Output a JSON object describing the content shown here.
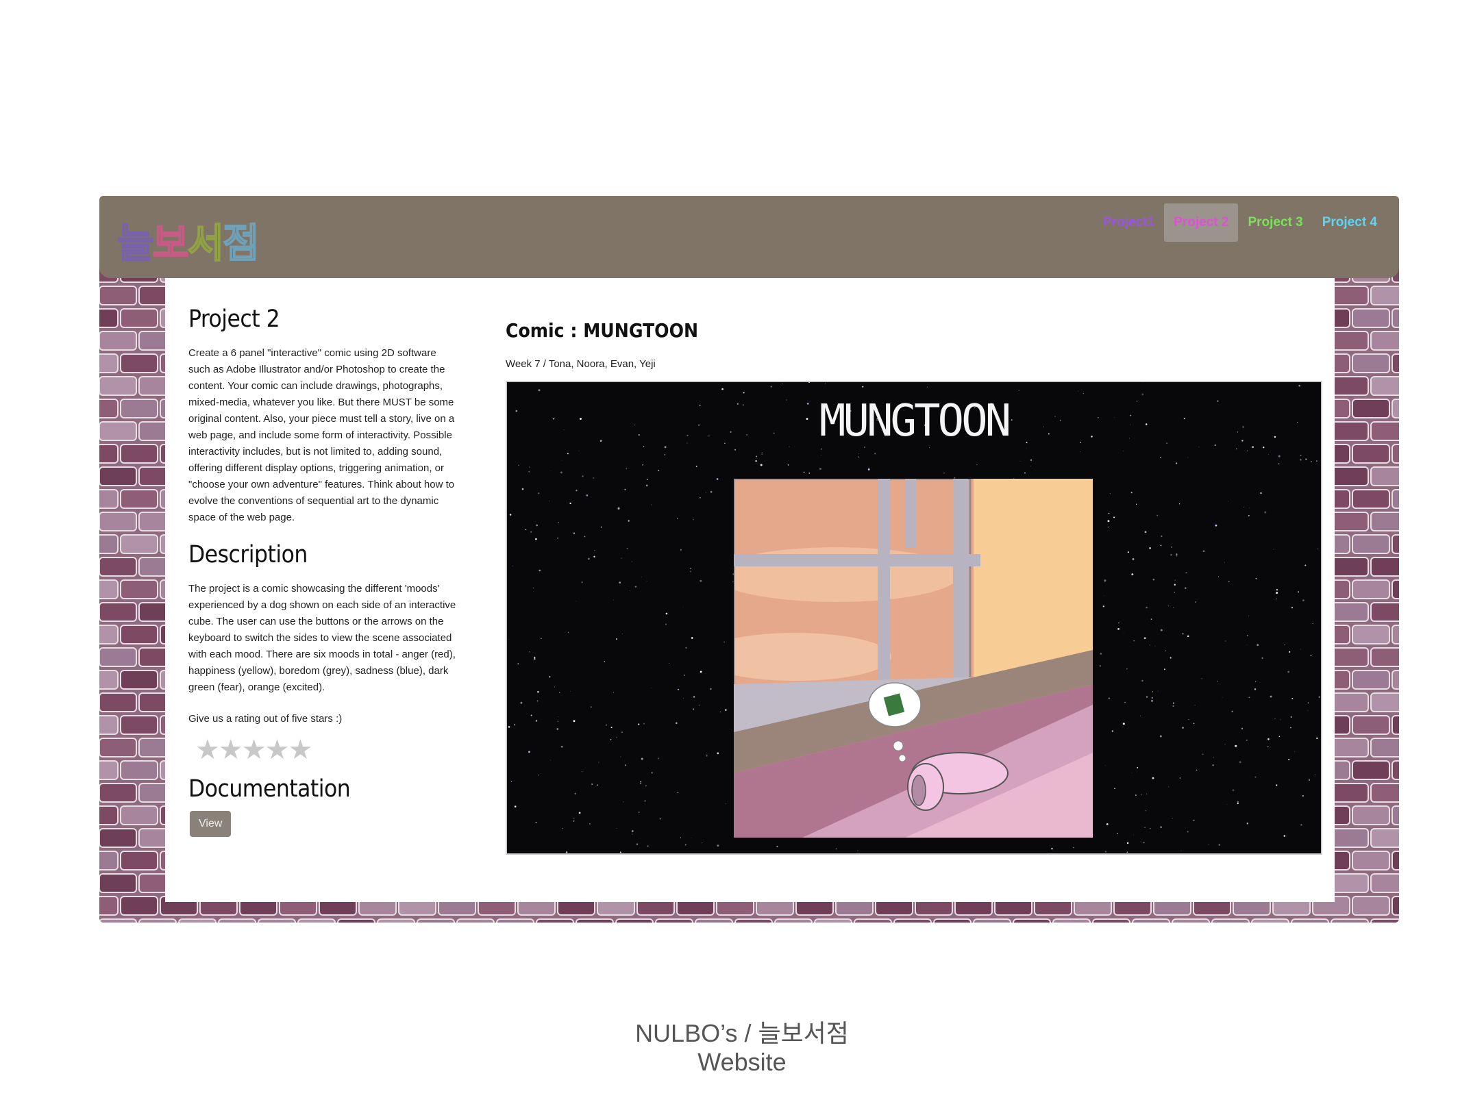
{
  "site": {
    "logo_text": "늘보서점",
    "nav": [
      {
        "label": "Project1",
        "color": "#9a55e0",
        "active": false
      },
      {
        "label": "Project 2",
        "color": "#e04fd8",
        "active": true
      },
      {
        "label": "Project 3",
        "color": "#7de05a",
        "active": false
      },
      {
        "label": "Project 4",
        "color": "#5fd4f0",
        "active": false
      }
    ]
  },
  "left": {
    "heading": "Project 2",
    "brief": "Create a 6 panel \"interactive\" comic using 2D software such as Adobe Illustrator and/or Photoshop to create the content. Your comic can include drawings, photographs, mixed-media, whatever you like. But there MUST be some original content. Also, your piece must tell a story, live on a web page, and include some form of interactivity. Possible interactivity includes, but is not limited to, adding sound, offering different display options, triggering animation, or \"choose your own adventure\" features. Think about how to evolve the conventions of sequential art to the dynamic space of the web page.",
    "description_heading": "Description",
    "description": "The project is a comic showcasing the different 'moods' experienced by a dog shown on each side of an interactive cube. The user can use the buttons or the arrows on the keyboard to switch the sides to view the scene associated with each mood. There are six moods in total - anger (red), happiness (yellow), boredom (grey), sadness (blue), dark green (fear), orange (excited).",
    "rating_prompt": "Give us a rating out of five stars :)",
    "rating": {
      "stars": 5,
      "filled": 0,
      "star_glyph": "★★★★★"
    },
    "documentation_heading": "Documentation",
    "view_label": "View"
  },
  "right": {
    "title": "Comic : MUNGTOON",
    "meta": "Week 7 / Tona, Noora, Evan, Yeji",
    "comic_logo": "MUNGTOON"
  },
  "caption": {
    "line1": "NULBO’s / 늘보서점",
    "line2": "Website"
  }
}
